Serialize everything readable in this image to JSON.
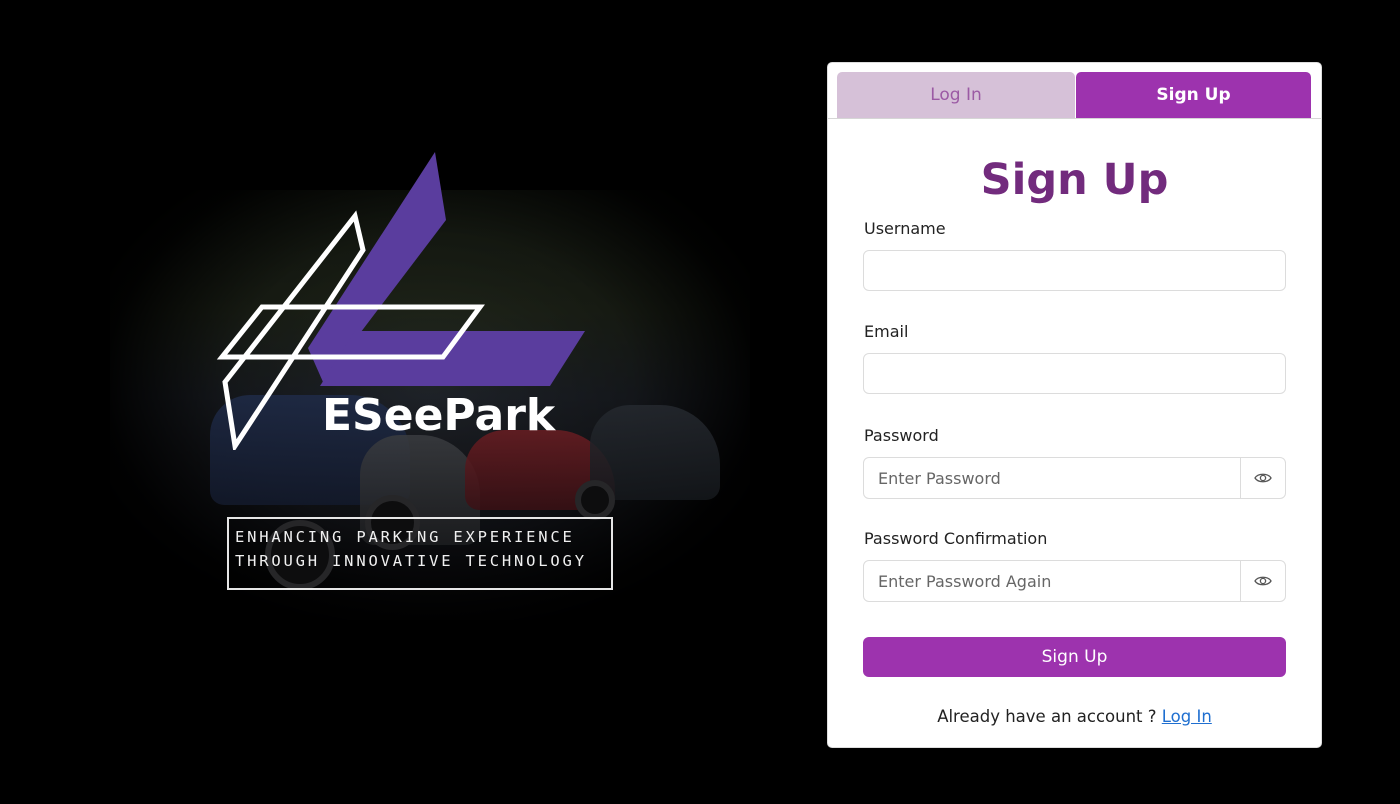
{
  "brand": {
    "name": "ESeePark",
    "tagline_line1": "ENHANCING PARKING EXPERIENCE",
    "tagline_line2": "THROUGH INNOVATIVE TECHNOLOGY",
    "logo_color": "#5a3d9e"
  },
  "tabs": {
    "login_label": "Log In",
    "signup_label": "Sign Up",
    "active": "Sign Up"
  },
  "form": {
    "title": "Sign Up",
    "username": {
      "label": "Username",
      "value": "",
      "placeholder": ""
    },
    "email": {
      "label": "Email",
      "value": "",
      "placeholder": ""
    },
    "password": {
      "label": "Password",
      "value": "",
      "placeholder": "Enter Password"
    },
    "password_confirmation": {
      "label": "Password Confirmation",
      "value": "",
      "placeholder": "Enter Password Again"
    },
    "submit_label": "Sign Up",
    "footer_text": "Already have an account ?",
    "footer_link": "Log In"
  },
  "colors": {
    "accent": "#9d33ae",
    "title": "#722b7d",
    "tab_inactive": "#d6c1d8",
    "link": "#1f6fd0"
  }
}
